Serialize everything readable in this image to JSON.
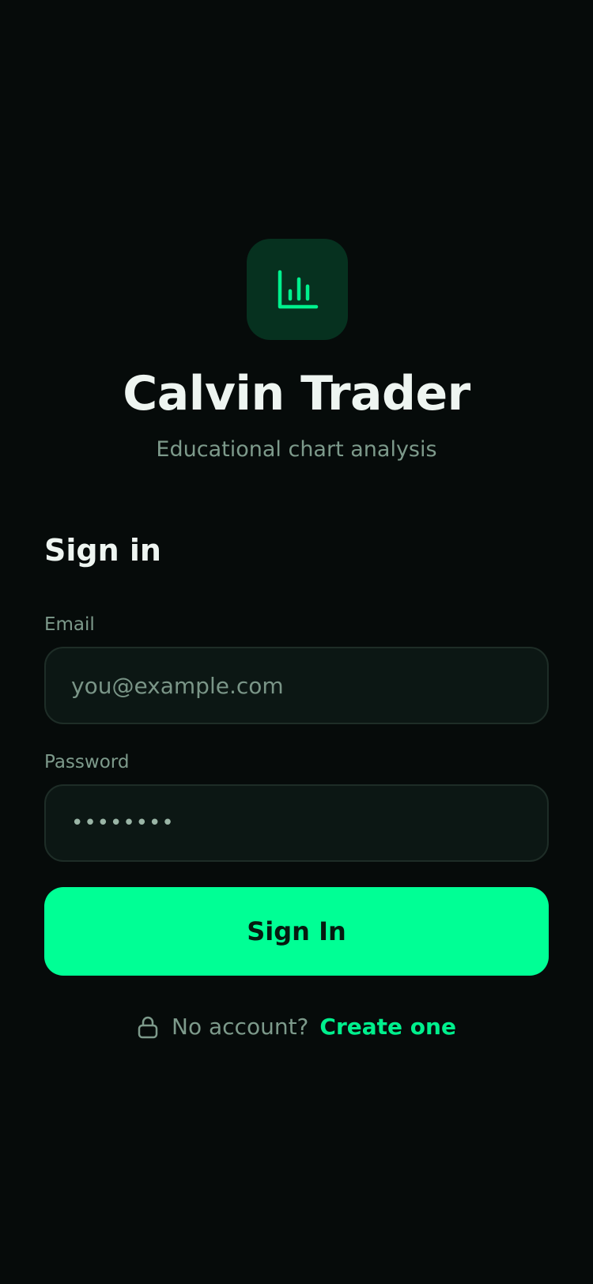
{
  "app": {
    "title": "Calvin Trader",
    "subtitle": "Educational chart analysis",
    "icon": "bar-chart-icon"
  },
  "form": {
    "heading": "Sign in",
    "email": {
      "label": "Email",
      "placeholder": "you@example.com",
      "value": ""
    },
    "password": {
      "label": "Password",
      "value": "••••••••"
    },
    "submit_label": "Sign In"
  },
  "footer": {
    "icon": "lock-icon",
    "prompt": "No account?",
    "link_label": "Create one"
  },
  "colors": {
    "background": "#060b0a",
    "accent": "#00ff95",
    "icon_tile": "#06311f"
  }
}
